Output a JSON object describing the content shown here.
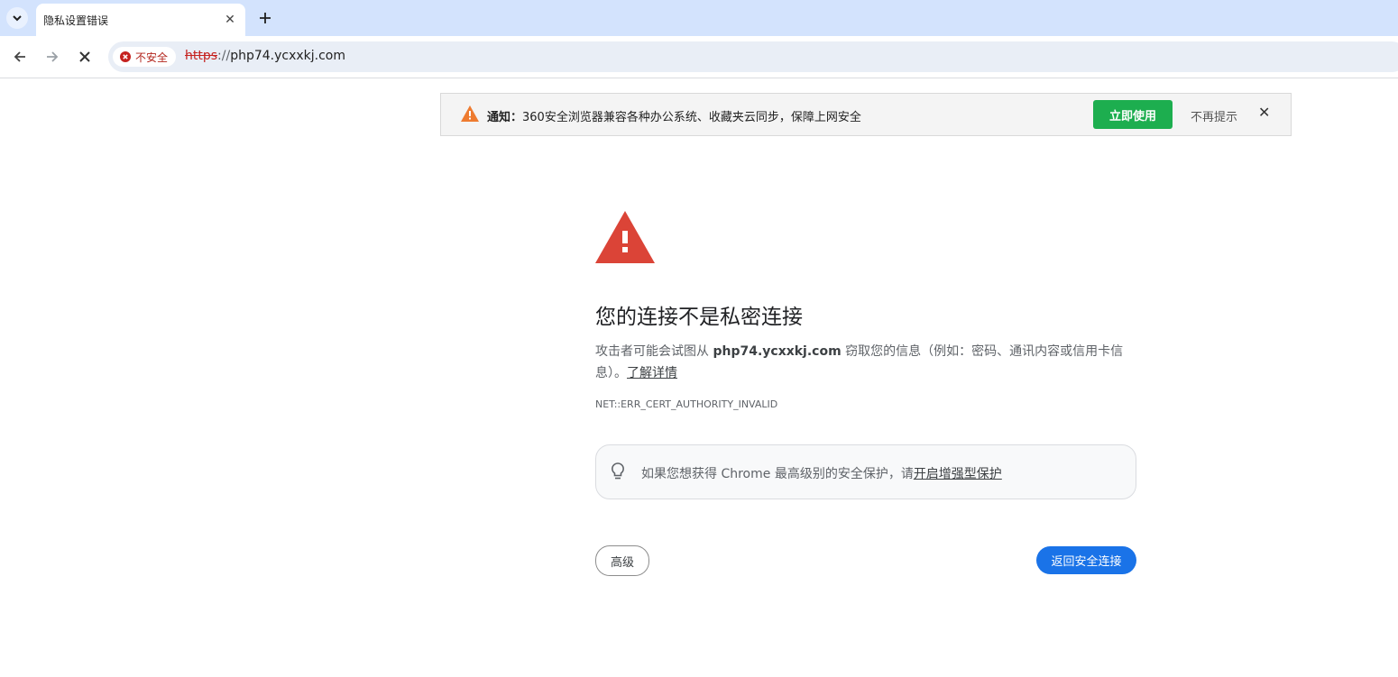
{
  "browser": {
    "tab": {
      "title": "隐私设置错误"
    },
    "address": {
      "security_chip": "不安全",
      "url_scheme": "https",
      "url_sep": "://",
      "url_host": "php74.ycxxkj.com"
    }
  },
  "notice": {
    "label": "通知：",
    "message": "360安全浏览器兼容各种办公系统、收藏夹云同步，保障上网安全",
    "cta": "立即使用",
    "dismiss": "不再提示"
  },
  "error": {
    "title": "您的连接不是私密连接",
    "desc_before": "攻击者可能会试图从 ",
    "desc_host": "php74.ycxxkj.com",
    "desc_after": " 窃取您的信息（例如：密码、通讯内容或信用卡信息）。",
    "learn_more": "了解详情",
    "code": "NET::ERR_CERT_AUTHORITY_INVALID",
    "enhanced_text": "如果您想获得 Chrome 最高级别的安全保护，请",
    "enhanced_link": "开启增强型保护",
    "advanced_button": "高级",
    "back_button": "返回安全连接"
  },
  "colors": {
    "tabstrip": "#d3e3fd",
    "primary_button": "#1a73e8",
    "notice_button": "#1dae4f",
    "warning_red": "#db4437"
  }
}
